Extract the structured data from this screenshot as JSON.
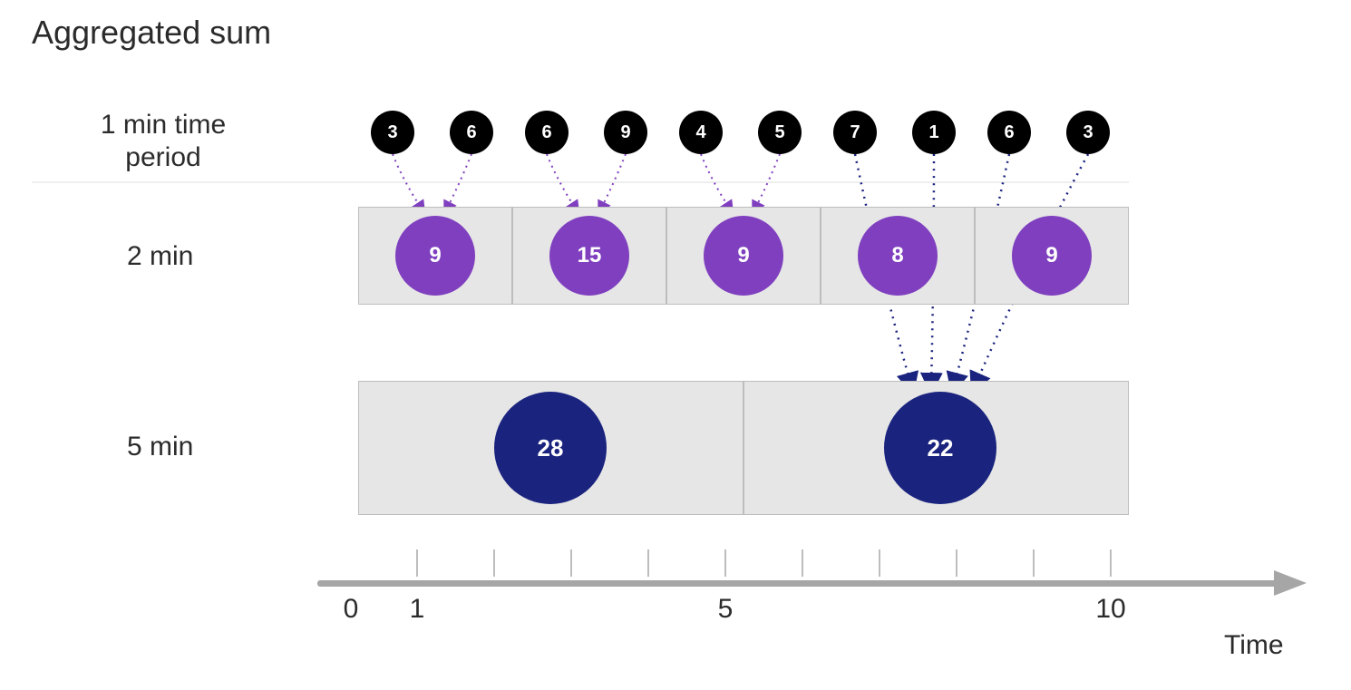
{
  "title": "Aggregated sum",
  "rows": {
    "one_min": {
      "label_line1": "1 min time",
      "label_line2": "period"
    },
    "two_min": {
      "label": "2 min"
    },
    "five_min": {
      "label": "5 min"
    }
  },
  "timeline": {
    "label": "Time",
    "ticks": [
      {
        "value": "0",
        "visible_number": true
      },
      {
        "value": "1",
        "visible_number": true
      },
      {
        "value": "2",
        "visible_number": false
      },
      {
        "value": "3",
        "visible_number": false
      },
      {
        "value": "4",
        "visible_number": false
      },
      {
        "value": "5",
        "visible_number": true
      },
      {
        "value": "6",
        "visible_number": false
      },
      {
        "value": "7",
        "visible_number": false
      },
      {
        "value": "8",
        "visible_number": false
      },
      {
        "value": "9",
        "visible_number": false
      },
      {
        "value": "10",
        "visible_number": true
      }
    ]
  },
  "chart_data": {
    "type": "aggregation_diagram",
    "aggregation_function": "sum",
    "x_unit": "minutes",
    "raw_1min": {
      "minutes": [
        1,
        2,
        3,
        4,
        5,
        6,
        7,
        8,
        9,
        10
      ],
      "values": [
        3,
        6,
        6,
        9,
        4,
        5,
        7,
        1,
        6,
        3
      ]
    },
    "agg_2min": {
      "bins": [
        "1-2",
        "3-4",
        "5-6",
        "7-8",
        "9-10"
      ],
      "values": [
        9,
        15,
        9,
        8,
        9
      ]
    },
    "agg_5min": {
      "bins": [
        "1-5",
        "6-10"
      ],
      "values": [
        28,
        22
      ]
    },
    "arrows_purple_from_raw_to_2min": [
      {
        "from_minute": 1,
        "to_bin": "1-2"
      },
      {
        "from_minute": 2,
        "to_bin": "1-2"
      },
      {
        "from_minute": 3,
        "to_bin": "3-4"
      },
      {
        "from_minute": 4,
        "to_bin": "3-4"
      },
      {
        "from_minute": 5,
        "to_bin": "5-6"
      },
      {
        "from_minute": 6,
        "to_bin": "5-6"
      }
    ],
    "arrows_navy_from_raw_to_5min": [
      {
        "from_minute": 7,
        "to_bin": "6-10"
      },
      {
        "from_minute": 8,
        "to_bin": "6-10"
      },
      {
        "from_minute": 9,
        "to_bin": "6-10"
      },
      {
        "from_minute": 10,
        "to_bin": "6-10"
      }
    ],
    "colors": {
      "raw": "#000000",
      "agg_2min": "#7f3fbf",
      "agg_5min": "#1a237e",
      "axis": "#a6a6a6",
      "box": "#e6e6e6"
    }
  }
}
